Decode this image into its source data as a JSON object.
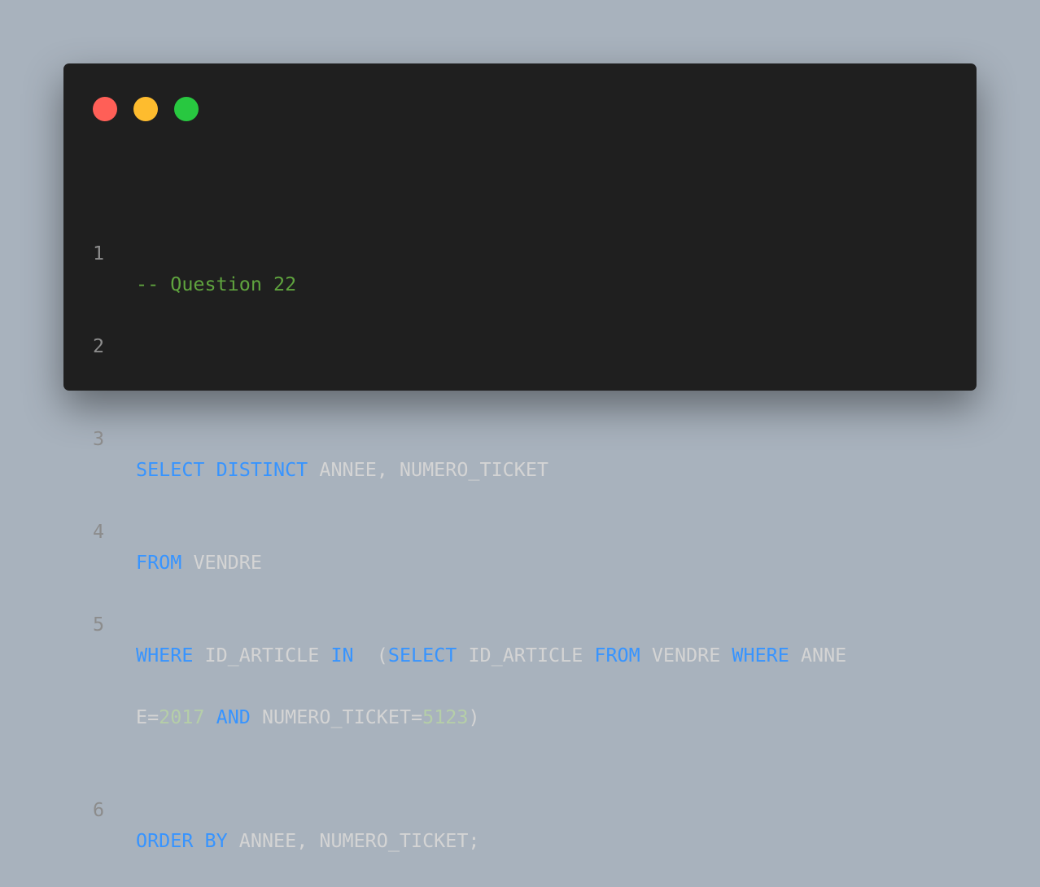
{
  "window": {
    "controls": [
      {
        "name": "close",
        "color": "#ff5f57"
      },
      {
        "name": "minimize",
        "color": "#febc2e"
      },
      {
        "name": "maximize",
        "color": "#28c840"
      }
    ]
  },
  "colors": {
    "background": "#a8b2bd",
    "editor_background": "#1f1f1f",
    "keyword": "#3794ff",
    "number": "#b5cea8",
    "comment": "#5fa33e",
    "text": "#d4d4d4",
    "line_number": "#8c8c8c"
  },
  "code": {
    "line_numbers": [
      "1",
      "2",
      "3",
      "4",
      "5",
      "6"
    ],
    "line1": {
      "comment": "-- Question 22"
    },
    "line3": {
      "kw_select": "SELECT",
      "kw_distinct": "DISTINCT",
      "text": "ANNEE, NUMERO_TICKET"
    },
    "line4": {
      "kw_from": "FROM",
      "text": "VENDRE"
    },
    "line5": {
      "kw_where": "WHERE",
      "text_id_article": "ID_ARTICLE",
      "kw_in": "IN",
      "text_paren": "(",
      "kw_select": "SELECT",
      "text_id_article2": "ID_ARTICLE",
      "kw_from": "FROM",
      "text_vendre": "VENDRE",
      "kw_where2": "WHERE",
      "text_anne": "ANNE"
    },
    "line5_wrap": {
      "text_e": "E=",
      "num_2017": "2017",
      "kw_and": "AND",
      "text_numero": "NUMERO_TICKET=",
      "num_5123": "5123",
      "text_close": ")"
    },
    "line6": {
      "kw_order": "ORDER",
      "kw_by": "BY",
      "text": "ANNEE, NUMERO_TICKET;"
    }
  }
}
